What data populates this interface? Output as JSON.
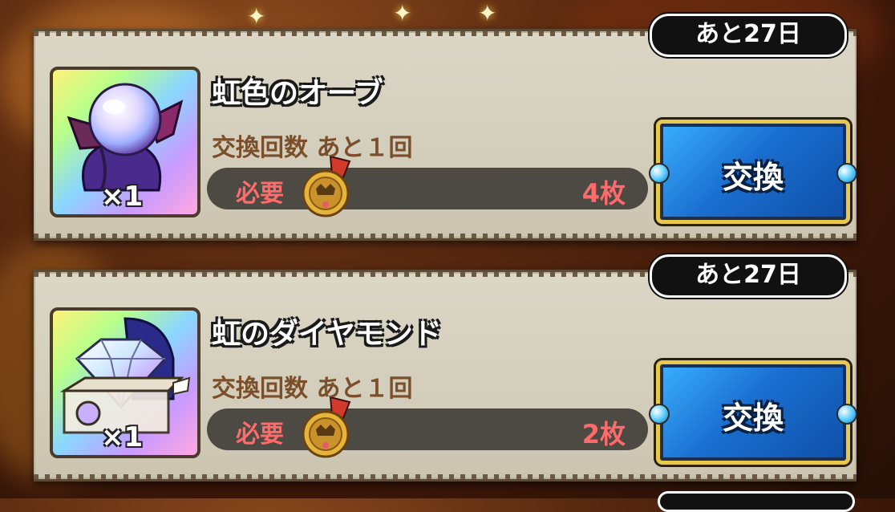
{
  "items": [
    {
      "deadline": "あと27日",
      "name": "虹色のオーブ",
      "quantity": "×1",
      "exchange_count": "交換回数 あと１回",
      "required_label": "必要",
      "required_amount": "4枚",
      "button_label": "交換",
      "icon": "rainbow-orb-icon"
    },
    {
      "deadline": "あと27日",
      "name": "虹のダイヤモンド",
      "quantity": "×1",
      "exchange_count": "交換回数 あと１回",
      "required_label": "必要",
      "required_amount": "2枚",
      "button_label": "交換",
      "icon": "rainbow-diamond-icon"
    }
  ],
  "colors": {
    "required_text": "#ff6a6a",
    "exchange_count_text": "#7a4f2a",
    "button_blue": "#1a6fd0",
    "button_border": "#e8c84a"
  }
}
